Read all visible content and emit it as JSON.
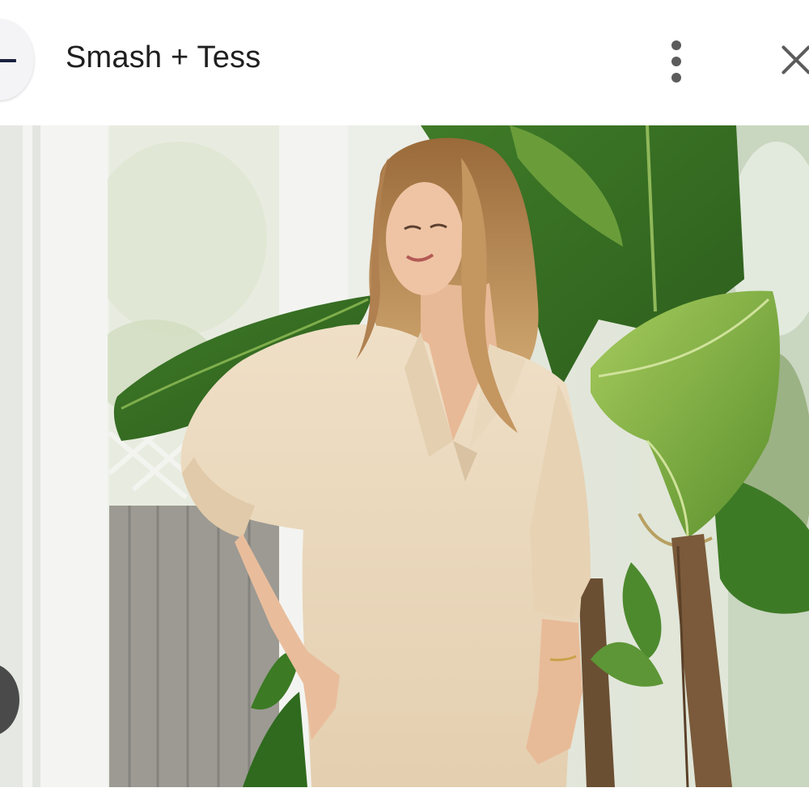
{
  "header": {
    "title": "Smash + Tess",
    "back_icon": "minus-icon",
    "menu_icon": "more-vert-icon",
    "close_icon": "close-icon"
  },
  "photo": {
    "colors": {
      "sweater": "#e9d6bb",
      "leaf": "#4f8a2c",
      "leaf_light": "#9cc35a",
      "window_frame": "#f3f4f1",
      "hair": "#b8874f"
    }
  }
}
